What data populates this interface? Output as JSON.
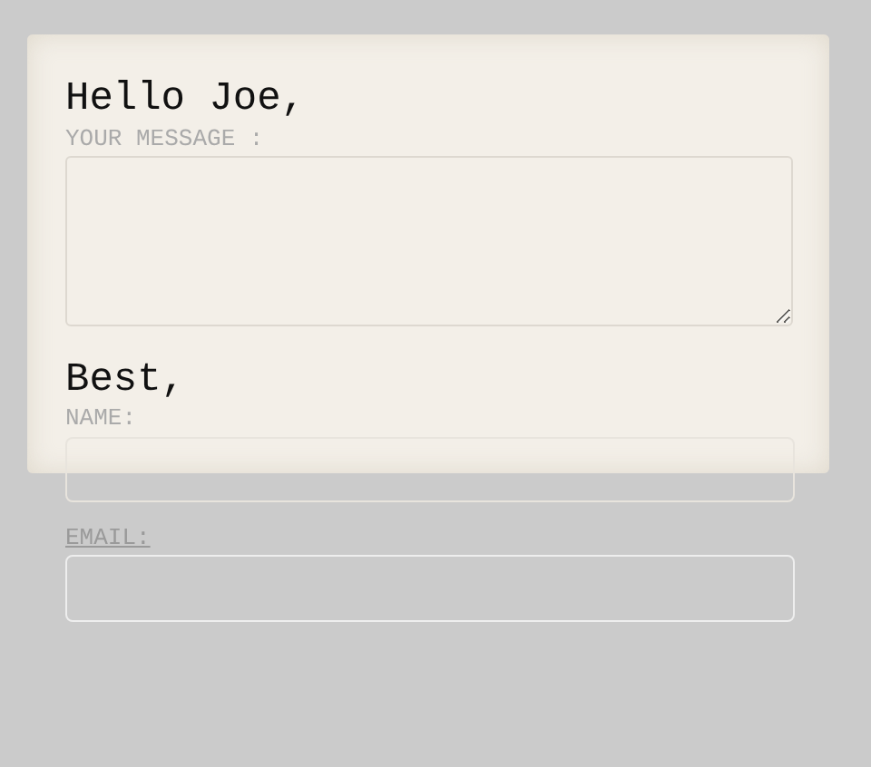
{
  "greeting": "Hello Joe,",
  "message_field": {
    "label": "YOUR MESSAGE :"
  },
  "closing": "Best,",
  "name_field": {
    "label": "NAME:"
  },
  "email_field": {
    "label": "EMAIL:"
  }
}
